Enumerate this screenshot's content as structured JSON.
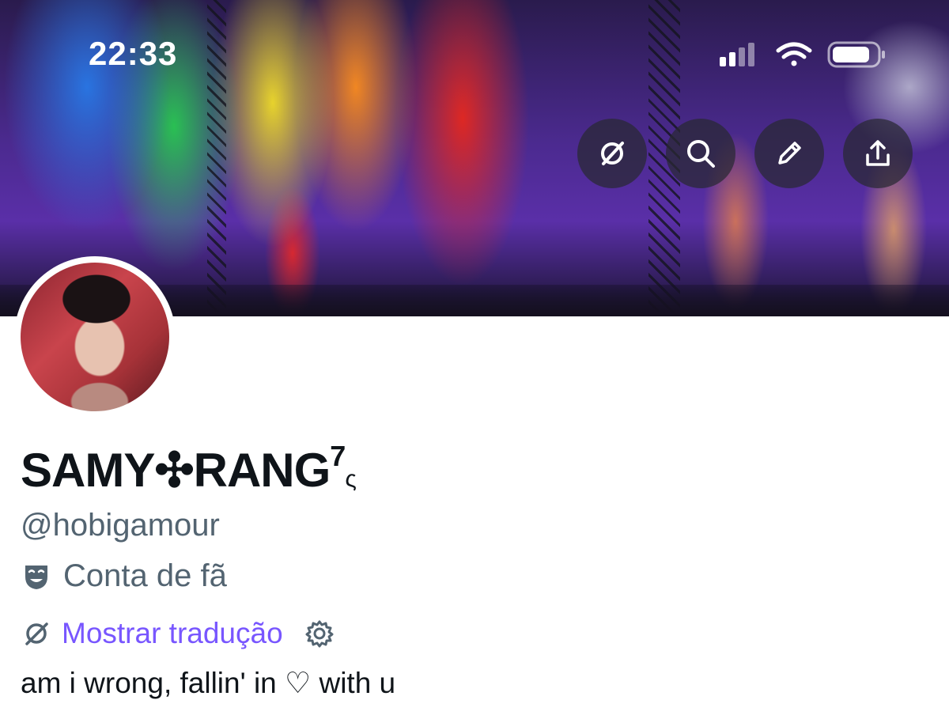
{
  "status_bar": {
    "time": "22:33",
    "icons": [
      "cellular-signal-icon",
      "wifi-icon",
      "battery-icon"
    ]
  },
  "header_actions": [
    {
      "name": "translate-button",
      "icon": "translate-icon"
    },
    {
      "name": "search-button",
      "icon": "search-icon"
    },
    {
      "name": "edit-button",
      "icon": "pencil-icon"
    },
    {
      "name": "share-button",
      "icon": "share-icon"
    }
  ],
  "profile": {
    "display_name": "SAMY✣RANG",
    "name_superscript": "7",
    "name_suffix": "ς",
    "handle": "@hobigamour",
    "label_icon": "theater-masks-icon",
    "label": "Conta de fã",
    "show_translation": "Mostrar tradução",
    "bio": "am i wrong, fallin' in ♡ with u"
  },
  "colors": {
    "link": "#7856ff",
    "secondary_text": "#536471",
    "primary_text": "#0f1419"
  }
}
